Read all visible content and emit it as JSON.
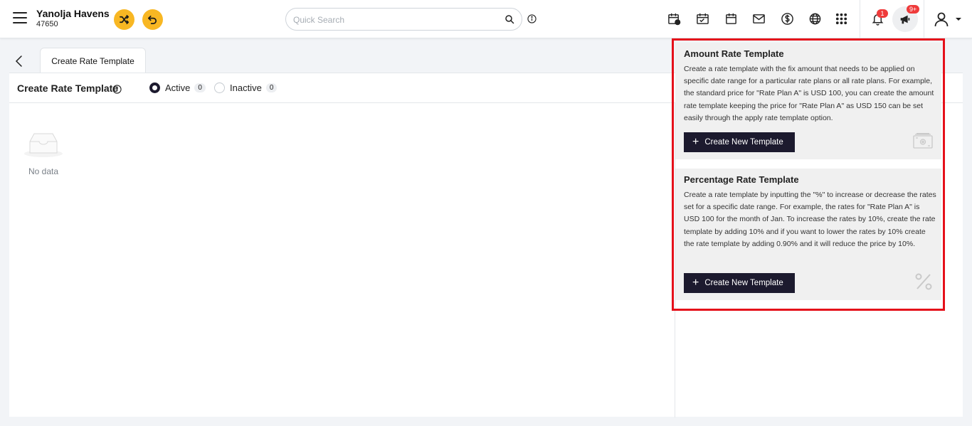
{
  "header": {
    "hotel_name": "Yanolja Havens",
    "hotel_id": "47650",
    "search_placeholder": "Quick Search",
    "notifications_badge": "1",
    "announcements_badge": "9+"
  },
  "tabs": [
    {
      "label": "Create Rate Template"
    }
  ],
  "page": {
    "title": "Create Rate Template",
    "filters": [
      {
        "label": "Active",
        "count": "0",
        "selected": true
      },
      {
        "label": "Inactive",
        "count": "0",
        "selected": false
      }
    ],
    "empty_text": "No data"
  },
  "cards": [
    {
      "title": "Amount Rate Template",
      "description": "Create a rate template with the fix amount that needs to be applied on specific date range for a particular rate plans or all rate plans. For example, the standard price for \"Rate Plan A\" is USD 100, you can create the amount rate template keeping the price for \"Rate Plan A\" as USD 150 can be set easily through the apply rate template option.",
      "button_label": "Create New Template",
      "icon": "cash-icon"
    },
    {
      "title": "Percentage Rate Template",
      "description": "Create a rate template by inputting the \"%\" to increase or decrease the rates set for a specific date range. For example, the rates for \"Rate Plan A\" is USD 100 for the month of Jan. To increase the rates by 10%, create the rate template by adding 10% and if you want to lower the rates by 10% create the rate template by adding 0.90% and it will reduce the price by 10%.",
      "button_label": "Create New Template",
      "icon": "percent-icon"
    }
  ],
  "colors": {
    "accent_yellow": "#f8b723",
    "button_dark": "#1c1a2e",
    "highlight_red": "#e5101a",
    "badge_red": "#ef3b3b"
  }
}
